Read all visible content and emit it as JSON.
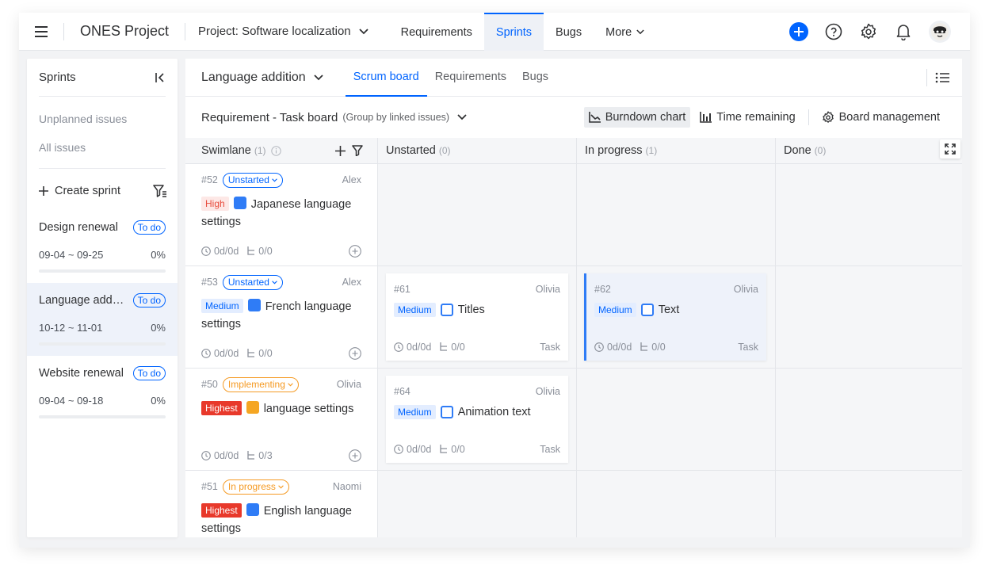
{
  "nav": {
    "app_title": "ONES Project",
    "project": "Project: Software localization",
    "tabs": [
      "Requirements",
      "Sprints",
      "Bugs",
      "More"
    ],
    "active_tab": "Sprints",
    "accent": "#0064ff"
  },
  "sidebar": {
    "title": "Sprints",
    "links": [
      "Unplanned issues",
      "All issues"
    ],
    "create_label": "Create sprint",
    "sprints": [
      {
        "name": "Design renewal",
        "status": "To do",
        "dates": "09-04 ~ 09-25",
        "progress": "0%",
        "fill": 0
      },
      {
        "name": "Language addition",
        "status": "To do",
        "dates": "10-12 ~ 11-01",
        "progress": "0%",
        "fill": 0
      },
      {
        "name": "Website renewal",
        "status": "To do",
        "dates": "09-04 ~ 09-18",
        "progress": "0%",
        "fill": 0
      }
    ]
  },
  "main": {
    "sprint_select": "Language addition",
    "tabs": [
      "Scrum board",
      "Requirements",
      "Bugs"
    ],
    "board_title": "Requirement - Task board",
    "board_sub": "(Group by linked issues)",
    "tools": {
      "burndown": "Burndown chart",
      "time_remaining": "Time remaining",
      "board_mgmt": "Board management"
    }
  },
  "board": {
    "columns": [
      {
        "label": "Swimlane",
        "count": "(1)"
      },
      {
        "label": "Unstarted",
        "count": "(0)"
      },
      {
        "label": "In progress",
        "count": "(1)"
      },
      {
        "label": "Done",
        "count": "(0)"
      }
    ],
    "lanes": [
      {
        "id": "#52",
        "status": "Unstarted",
        "assignee": "Alex",
        "priority": "High",
        "title": "Japanese language settings",
        "time": "0d/0d",
        "sub": "0/0"
      },
      {
        "id": "#53",
        "status": "Unstarted",
        "assignee": "Alex",
        "priority": "Medium",
        "title": "French language settings",
        "time": "0d/0d",
        "sub": "0/0"
      },
      {
        "id": "#50",
        "status": "Implementing",
        "assignee": "Olivia",
        "priority": "Highest",
        "title": "language settings",
        "time": "0d/0d",
        "sub": "0/3"
      },
      {
        "id": "#51",
        "status": "In progress",
        "assignee": "Naomi",
        "priority": "Highest",
        "title": "English language settings",
        "time": "",
        "sub": ""
      }
    ],
    "cards": [
      {
        "id": "#61",
        "assignee": "Olivia",
        "priority": "Medium",
        "title": "Titles",
        "time": "0d/0d",
        "sub": "0/0",
        "type": "Task"
      },
      {
        "id": "#62",
        "assignee": "Olivia",
        "priority": "Medium",
        "title": "Text",
        "time": "0d/0d",
        "sub": "0/0",
        "type": "Task"
      },
      {
        "id": "#64",
        "assignee": "Olivia",
        "priority": "Medium",
        "title": "Animation text",
        "time": "0d/0d",
        "sub": "0/0",
        "type": "Task"
      }
    ]
  }
}
